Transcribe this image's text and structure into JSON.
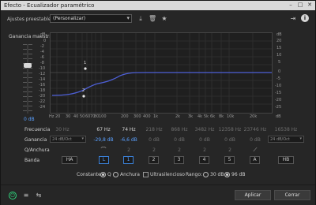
{
  "window": {
    "title": "Efecto - Ecualizador paramétrico",
    "minimize": "–",
    "maximize": "□",
    "close": "✕"
  },
  "presets": {
    "label": "Ajustes preestablecidos:",
    "value": "(Personalizar)"
  },
  "graph": {
    "gain_label": "Ganancia maestra",
    "gain_value": "0 dB",
    "left_scale": [
      "dB",
      "0",
      "-2",
      "-4",
      "-6",
      "-8",
      "-10",
      "-12",
      "-14",
      "-16",
      "-18",
      "-20",
      "-22",
      "-24"
    ],
    "right_scale": [
      "dB",
      "20",
      "15",
      "10",
      "5",
      "0",
      "-5",
      "-10",
      "-15",
      "-20",
      "-25",
      "-30"
    ],
    "hz_labels": [
      "Hz",
      "20",
      "30",
      "40",
      "50",
      "60",
      "70",
      "80",
      "100",
      "200",
      "300",
      "400",
      "1k",
      "2k",
      "3k",
      "4k",
      "5k",
      "6k",
      "8k",
      "10k",
      "20k"
    ],
    "db_corner": "dB",
    "markers": {
      "m1": "1",
      "m2": "2"
    },
    "curve_color": "#4d5fd6"
  },
  "bands": {
    "labels": {
      "frequency": "Frecuencia",
      "gain": "Ganancia",
      "q_width": "Q/Anchura",
      "band": "Banda"
    },
    "frequency": [
      "30 Hz",
      "67 Hz",
      "74 Hz",
      "218 Hz",
      "868 Hz",
      "3482 Hz",
      "12358 Hz",
      "23746 Hz",
      "16538 Hz"
    ],
    "gain_left_select": "24 dB/Oct",
    "gain": [
      "-29,8 dB",
      "-6,6 dB",
      "0 dB",
      "0 dB",
      "0 dB",
      "0 dB",
      "0 dB"
    ],
    "gain_right_select": "24 dB/Oct",
    "q": [
      "2",
      "2",
      "2",
      "2",
      "2"
    ],
    "band_buttons": [
      "HA",
      "L",
      "1",
      "2",
      "3",
      "4",
      "5",
      "A",
      "HB"
    ],
    "shape_icons": [
      "shelf-low-icon",
      "shelf-high-icon"
    ]
  },
  "options": {
    "constant_label": "Constante:",
    "q_label": "Q",
    "width_label": "Anchura",
    "ultrasonic_label": "Ultrasilencioso",
    "range_label": "Rango:",
    "range_30": "30 dB",
    "range_96": "96 dB"
  },
  "footer": {
    "apply": "Aplicar",
    "close": "Cerrar"
  },
  "colors": {
    "accent": "#5aa0ff",
    "power": "#2fd37b",
    "curve": "#4d5fd6"
  }
}
